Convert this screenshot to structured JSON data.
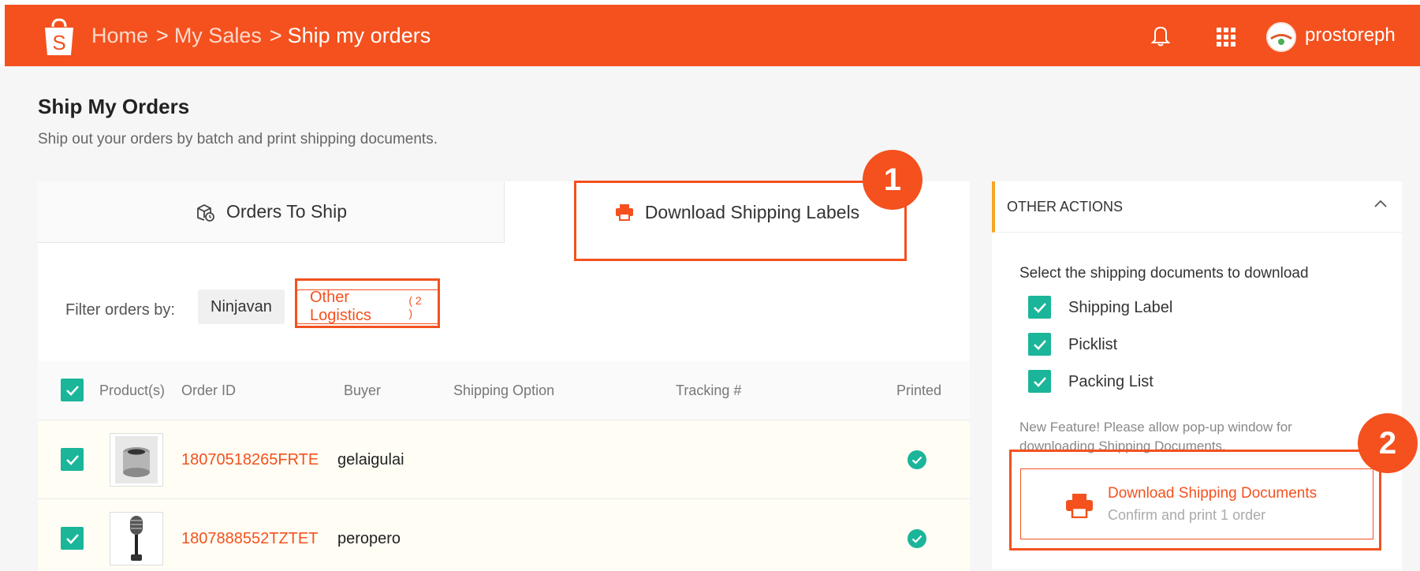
{
  "breadcrumb": {
    "home": "Home",
    "my_sales": "My Sales",
    "current": "Ship my orders",
    "separator": ">"
  },
  "header": {
    "username": "prostoreph"
  },
  "page": {
    "title": "Ship My Orders",
    "subtitle": "Ship out your orders by batch and print shipping documents."
  },
  "tabs": {
    "orders_to_ship": "Orders To Ship",
    "download_labels": "Download Shipping Labels"
  },
  "filter": {
    "label": "Filter orders by:",
    "ninjavan": "Ninjavan",
    "other": "Other Logistics",
    "other_count": "( 2 )"
  },
  "table": {
    "columns": [
      "Product(s)",
      "Order ID",
      "Buyer",
      "Shipping Option",
      "Tracking #",
      "Printed"
    ],
    "rows": [
      {
        "order_id": "18070518265FRTE",
        "buyer": "gelaigulai",
        "product_icon": "speaker-icon",
        "printed": true
      },
      {
        "order_id": "1807888552TZTET",
        "buyer": "peropero",
        "product_icon": "microphone-icon",
        "printed": true
      }
    ]
  },
  "side": {
    "header": "OTHER ACTIONS",
    "prompt": "Select the shipping documents to download",
    "options": [
      "Shipping Label",
      "Picklist",
      "Packing List"
    ],
    "notice": "New Feature! Please allow pop-up window for downloading Shipping Documents.",
    "button_title": "Download Shipping Documents",
    "button_sub": "Confirm and print 1 order"
  },
  "annotations": {
    "step1": "1",
    "step2": "2"
  },
  "colors": {
    "brand": "#f4511e",
    "check": "#1bb59a",
    "accent_border": "#f5a623"
  }
}
